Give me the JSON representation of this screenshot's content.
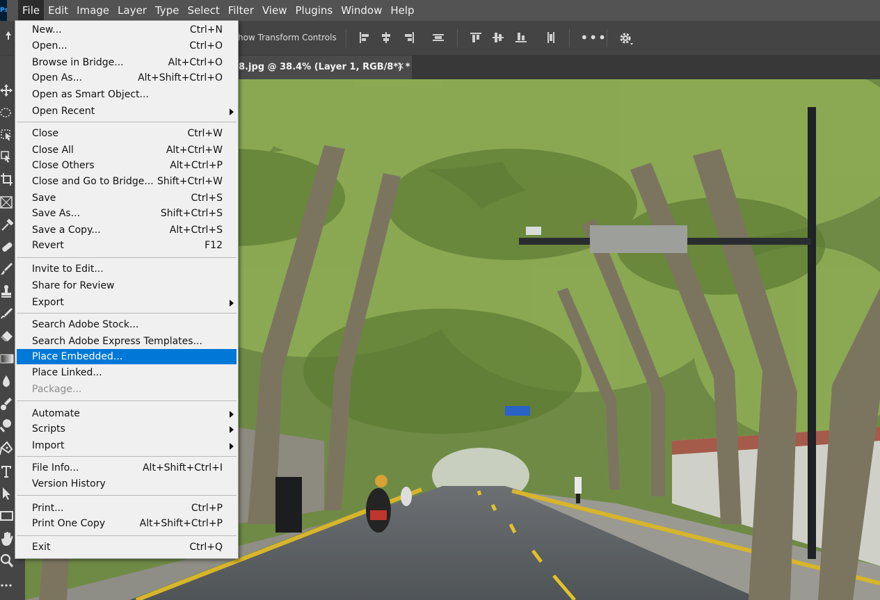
{
  "app": {
    "logo_text": "Ps",
    "colors": {
      "menu_highlight": "#0078d7",
      "menu_bg": "#f0f0f0",
      "ui_dark": "#535353",
      "logo_bg": "#001e36"
    }
  },
  "menubar": {
    "items": [
      "File",
      "Edit",
      "Image",
      "Layer",
      "Type",
      "Select",
      "Filter",
      "View",
      "Plugins",
      "Window",
      "Help"
    ]
  },
  "options_bar": {
    "show_transform_label": "how Transform Controls",
    "icons": [
      "align-left-icon",
      "align-center-horizontal-icon",
      "align-right-icon",
      "distribute-horizontal-icon",
      "align-top-icon",
      "align-middle-vertical-icon",
      "align-bottom-icon",
      "distribute-vertical-icon",
      "more-options-icon",
      "gear-icon"
    ],
    "more_glyph": "•••"
  },
  "document_tab": {
    "title": "8.jpg @ 38.4% (Layer 1, RGB/8*) *",
    "close_glyph": "×"
  },
  "toolbar": {
    "tools": [
      "move-tool-icon",
      "marquee-tool-icon",
      "object-selection-tool-icon",
      "crop-tool-icon",
      "frame-tool-icon",
      "eyedropper-tool-icon",
      "healing-brush-tool-icon",
      "brush-tool-icon",
      "clone-stamp-tool-icon",
      "history-brush-tool-icon",
      "eraser-tool-icon",
      "gradient-tool-icon",
      "blur-tool-icon",
      "dodge-tool-icon",
      "pen-tool-icon",
      "type-tool-icon",
      "path-selection-tool-icon",
      "rectangle-tool-icon",
      "hand-tool-icon",
      "zoom-tool-icon",
      "more-tools-icon"
    ]
  },
  "file_menu": {
    "items": [
      {
        "label": "New...",
        "shortcut": "Ctrl+N"
      },
      {
        "label": "Open...",
        "shortcut": "Ctrl+O"
      },
      {
        "label": "Browse in Bridge...",
        "shortcut": "Alt+Ctrl+O"
      },
      {
        "label": "Open As...",
        "shortcut": "Alt+Shift+Ctrl+O"
      },
      {
        "label": "Open as Smart Object...",
        "shortcut": ""
      },
      {
        "label": "Open Recent",
        "shortcut": "",
        "submenu": true
      },
      {
        "label": "Close",
        "shortcut": "Ctrl+W"
      },
      {
        "label": "Close All",
        "shortcut": "Alt+Ctrl+W"
      },
      {
        "label": "Close Others",
        "shortcut": "Alt+Ctrl+P"
      },
      {
        "label": "Close and Go to Bridge...",
        "shortcut": "Shift+Ctrl+W"
      },
      {
        "label": "Save",
        "shortcut": "Ctrl+S"
      },
      {
        "label": "Save As...",
        "shortcut": "Shift+Ctrl+S"
      },
      {
        "label": "Save a Copy...",
        "shortcut": "Alt+Ctrl+S"
      },
      {
        "label": "Revert",
        "shortcut": "F12"
      },
      {
        "label": "Invite to Edit...",
        "shortcut": ""
      },
      {
        "label": "Share for Review",
        "shortcut": ""
      },
      {
        "label": "Export",
        "shortcut": "",
        "submenu": true
      },
      {
        "label": "Search Adobe Stock...",
        "shortcut": ""
      },
      {
        "label": "Search Adobe Express Templates...",
        "shortcut": ""
      },
      {
        "label": "Place Embedded...",
        "shortcut": "",
        "highlighted": true
      },
      {
        "label": "Place Linked...",
        "shortcut": ""
      },
      {
        "label": "Package...",
        "shortcut": "",
        "disabled": true
      },
      {
        "label": "Automate",
        "shortcut": "",
        "submenu": true
      },
      {
        "label": "Scripts",
        "shortcut": "",
        "submenu": true
      },
      {
        "label": "Import",
        "shortcut": "",
        "submenu": true
      },
      {
        "label": "File Info...",
        "shortcut": "Alt+Shift+Ctrl+I"
      },
      {
        "label": "Version History",
        "shortcut": ""
      },
      {
        "label": "Print...",
        "shortcut": "Ctrl+P"
      },
      {
        "label": "Print One Copy",
        "shortcut": "Alt+Shift+Ctrl+P"
      },
      {
        "label": "Exit",
        "shortcut": "Ctrl+Q"
      }
    ]
  }
}
